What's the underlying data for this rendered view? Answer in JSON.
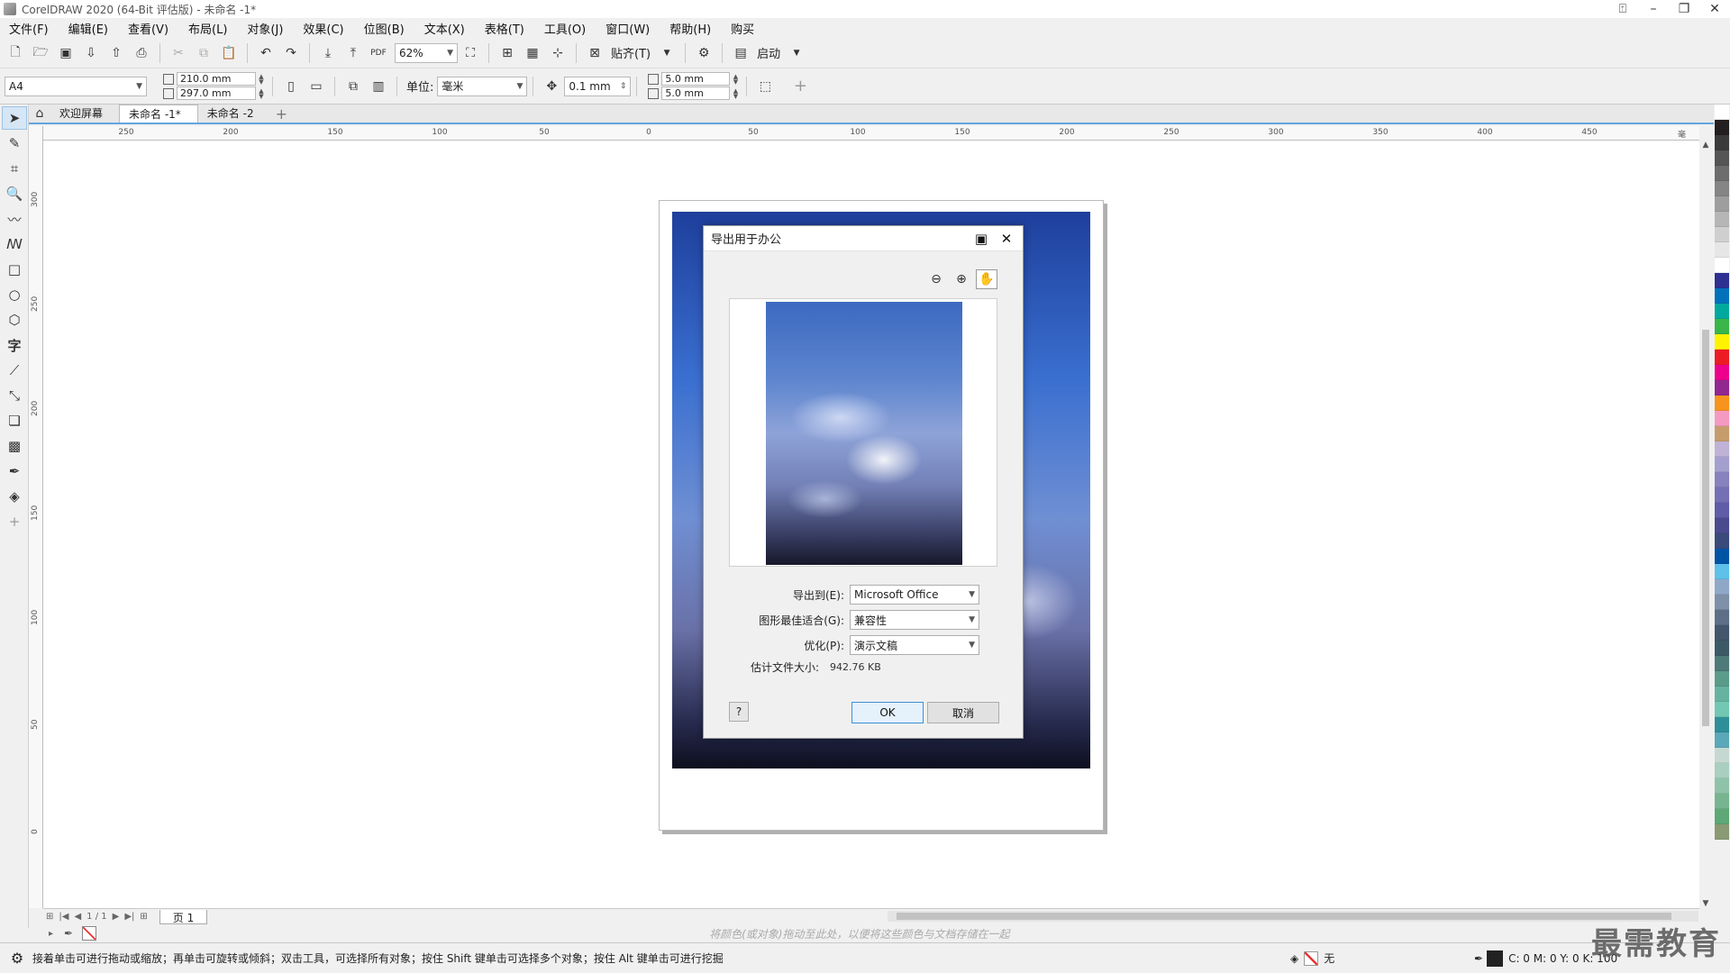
{
  "titlebar": {
    "title": "CorelDRAW 2020 (64-Bit 评估版) - 未命名 -1*"
  },
  "menus": [
    "文件(F)",
    "编辑(E)",
    "查看(V)",
    "布局(L)",
    "对象(J)",
    "效果(C)",
    "位图(B)",
    "文本(X)",
    "表格(T)",
    "工具(O)",
    "窗口(W)",
    "帮助(H)",
    "购买"
  ],
  "toolbar": {
    "zoom": "62%",
    "snap_label": "贴齐(T)",
    "launch_label": "启动"
  },
  "propbar": {
    "page_size": "A4",
    "width": "210.0 mm",
    "height": "297.0 mm",
    "unit_label": "单位:",
    "unit_value": "毫米",
    "nudge": "0.1 mm",
    "dup_x": "5.0 mm",
    "dup_y": "5.0 mm"
  },
  "tabs": [
    "欢迎屏幕",
    "未命名 -1*",
    "未命名 -2"
  ],
  "ruler_h": [
    "250",
    "200",
    "150",
    "100",
    "50",
    "0",
    "50",
    "100",
    "150",
    "200",
    "250",
    "300",
    "350",
    "400",
    "450"
  ],
  "ruler_h_unit": "毫米",
  "ruler_v": [
    "300",
    "250",
    "200",
    "150",
    "100",
    "50",
    "0"
  ],
  "dialog": {
    "title": "导出用于办公",
    "export_to_label": "导出到(E):",
    "export_to_value": "Microsoft Office",
    "graphic_fit_label": "图形最佳适合(G):",
    "graphic_fit_value": "兼容性",
    "optimize_label": "优化(P):",
    "optimize_value": "演示文稿",
    "filesize_label": "估计文件大小:",
    "filesize_value": "942.76 KB",
    "help_label": "?",
    "ok_label": "OK",
    "cancel_label": "取消"
  },
  "bottom": {
    "page_counter": "1 / 1",
    "page_tab": "页 1",
    "color_hint": "将颜色(或对象)拖动至此处，以便将这些颜色与文档存储在一起"
  },
  "status": {
    "message": "接着单击可进行拖动或缩放；再单击可旋转或倾斜；双击工具，可选择所有对象；按住 Shift 键单击可选择多个对象；按住 Alt 键单击可进行挖掘",
    "fill_label": "无",
    "outline_values": "C: 0 M: 0 Y: 0 K: 100"
  },
  "watermark": "最需教育",
  "palette": [
    "#ffffff",
    "#231f20",
    "#3b3b3b",
    "#555555",
    "#6d6d6d",
    "#858585",
    "#9e9e9e",
    "#b6b6b6",
    "#cfcfcf",
    "#e6e6e6",
    "#ffffff",
    "#2e3192",
    "#0072bc",
    "#00a99d",
    "#39b54a",
    "#fff200",
    "#ed1c24",
    "#ec008c",
    "#92278f",
    "#f7941d",
    "#f49ac1",
    "#c69c6d",
    "#bfb2d6",
    "#a3a0d0",
    "#8781bd",
    "#7570b3",
    "#605ca8",
    "#4b4a8e",
    "#3a4a7b",
    "#0054a6",
    "#5dc1e9",
    "#8fa8c8",
    "#7e8fa8",
    "#5c6f87",
    "#44566b",
    "#3c5a66",
    "#4e7a7a",
    "#5b9b8a",
    "#66b2a0",
    "#72c7b3",
    "#2f8f99",
    "#5aa8b8",
    "#c6d8d2",
    "#a8cfc0",
    "#8fc3a9",
    "#76b58f",
    "#5ea876",
    "#8a9a73"
  ]
}
